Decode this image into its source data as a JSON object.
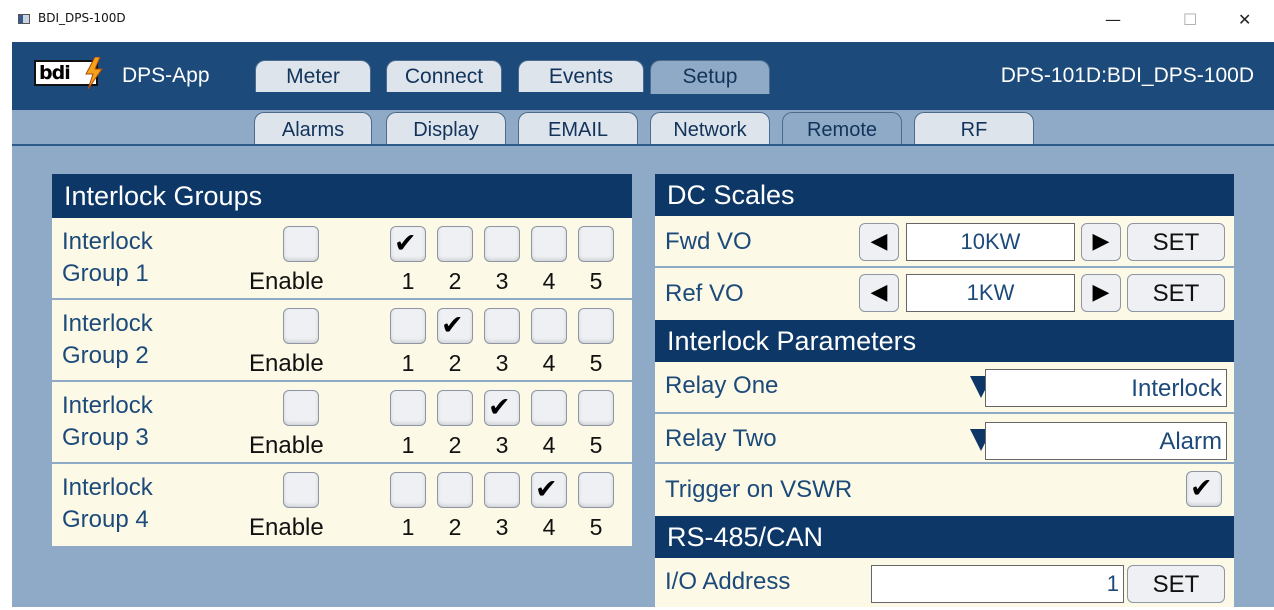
{
  "window": {
    "title": "BDI_DPS-100D",
    "minimize": "—",
    "maximize": "☐",
    "close": "✕"
  },
  "app": {
    "logo_text": "bdi",
    "name": "DPS-App",
    "device": "DPS-101D:BDI_DPS-100D"
  },
  "tabs": [
    {
      "label": "Meter",
      "active": false
    },
    {
      "label": "Connect",
      "active": false
    },
    {
      "label": "Events",
      "active": false
    },
    {
      "label": "Setup",
      "active": true
    }
  ],
  "subtabs": [
    {
      "label": "Alarms",
      "active": false
    },
    {
      "label": "Display",
      "active": false
    },
    {
      "label": "EMAIL",
      "active": false
    },
    {
      "label": "Network",
      "active": false
    },
    {
      "label": "Remote",
      "active": true
    },
    {
      "label": "RF",
      "active": false
    }
  ],
  "interlock_groups": {
    "title": "Interlock Groups",
    "enable_label": "Enable",
    "numbers": [
      "1",
      "2",
      "3",
      "4",
      "5"
    ],
    "groups": [
      {
        "line1": "Interlock",
        "line2": "Group 1",
        "enabled": false,
        "checked": [
          true,
          false,
          false,
          false,
          false
        ]
      },
      {
        "line1": "Interlock",
        "line2": "Group 2",
        "enabled": false,
        "checked": [
          false,
          true,
          false,
          false,
          false
        ]
      },
      {
        "line1": "Interlock",
        "line2": "Group 3",
        "enabled": false,
        "checked": [
          false,
          false,
          true,
          false,
          false
        ]
      },
      {
        "line1": "Interlock",
        "line2": "Group 4",
        "enabled": false,
        "checked": [
          false,
          false,
          false,
          true,
          false
        ]
      }
    ]
  },
  "dc_scales": {
    "title": "DC Scales",
    "left_arrow": "◀",
    "right_arrow": "▶",
    "set_label": "SET",
    "fwd": {
      "label": "Fwd VO",
      "value": "10KW"
    },
    "ref": {
      "label": "Ref VO",
      "value": "1KW"
    }
  },
  "interlock_params": {
    "title": "Interlock Parameters",
    "relay_one": {
      "label": "Relay One",
      "value": "Interlock"
    },
    "relay_two": {
      "label": "Relay Two",
      "value": "Alarm"
    },
    "trigger": {
      "label": "Trigger on VSWR",
      "checked": true
    }
  },
  "rs485": {
    "title": "RS-485/CAN",
    "io_label": "I/O Address",
    "io_value": "1",
    "set_label": "SET"
  },
  "check_glyph": "✔",
  "colors": {
    "navy": "#0c3766",
    "dark_blue": "#1c4a7a",
    "panel_bg": "#fcf9e6",
    "frame": "#8eaac6"
  }
}
